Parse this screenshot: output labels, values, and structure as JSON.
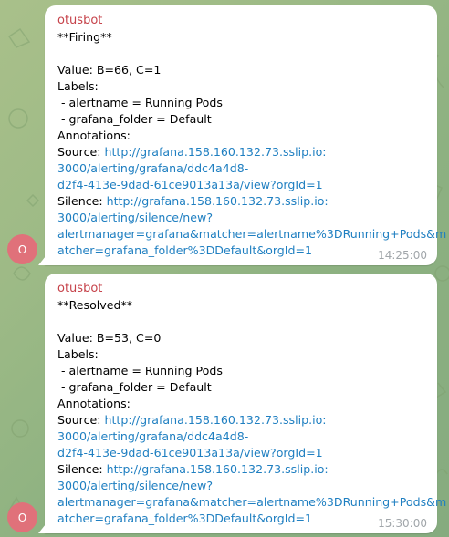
{
  "messages": [
    {
      "sender": "otusbot",
      "avatar_letter": "O",
      "time": "14:25:00",
      "status": "**Firing**",
      "value": "Value: B=66, C=1",
      "labels_heading": "Labels:",
      "label_alertname": " - alertname = Running Pods",
      "label_folder": " - grafana_folder = Default",
      "annotations_heading": "Annotations:",
      "source_prefix": "Source: ",
      "source_link_lines": [
        "http://grafana.158.160.132.73.sslip.io:",
        "3000/alerting/grafana/ddc4a4d8-",
        "d2f4-413e-9dad-61ce9013a13a/view?orgId=1"
      ],
      "silence_prefix": "Silence: ",
      "silence_link_lines": [
        "http://grafana.158.160.132.73.sslip.io:",
        "3000/alerting/silence/new?",
        "alertmanager=grafana&matcher=alertname%3DRunning+Pods&m",
        "atcher=grafana_folder%3DDefault&orgId=1"
      ]
    },
    {
      "sender": "otusbot",
      "avatar_letter": "O",
      "time": "15:30:00",
      "status": "**Resolved**",
      "value": "Value: B=53, C=0",
      "labels_heading": "Labels:",
      "label_alertname": " - alertname = Running Pods",
      "label_folder": " - grafana_folder = Default",
      "annotations_heading": "Annotations:",
      "source_prefix": "Source: ",
      "source_link_lines": [
        "http://grafana.158.160.132.73.sslip.io:",
        "3000/alerting/grafana/ddc4a4d8-",
        "d2f4-413e-9dad-61ce9013a13a/view?orgId=1"
      ],
      "silence_prefix": "Silence: ",
      "silence_link_lines": [
        "http://grafana.158.160.132.73.sslip.io:",
        "3000/alerting/silence/new?",
        "alertmanager=grafana&matcher=alertname%3DRunning+Pods&m",
        "atcher=grafana_folder%3DDefault&orgId=1"
      ]
    }
  ],
  "colors": {
    "sender": "#c6424a",
    "link": "#1f7fc1",
    "avatar": "#e0717a",
    "time": "#a1a6aa"
  }
}
